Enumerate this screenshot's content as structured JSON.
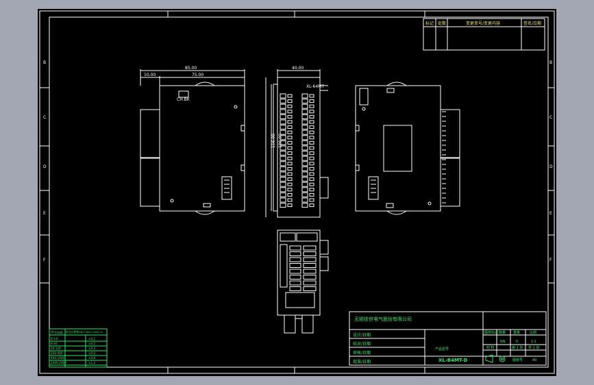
{
  "revision_table": {
    "headers": [
      "标记",
      "处数",
      "变更单号/变更内容",
      "签名/日期"
    ]
  },
  "margin_marks": {
    "left": [
      "B",
      "C",
      "D",
      "E",
      "F"
    ],
    "right": [
      "B",
      "C",
      "D",
      "E",
      "F"
    ]
  },
  "dimensions": {
    "top_overall": "85.00",
    "top_inner": "75.00",
    "top_left": "10.00",
    "side_width": "40.00",
    "side_height_a": "116.00",
    "side_height_b": "100.00",
    "model_tag": "XL-64MT"
  },
  "title_block": {
    "company": "无锡佳世电气股份有限公司",
    "rows": [
      "设计/日期",
      "校对/日期",
      "审核/日期",
      "批准/日期"
    ],
    "headers": [
      "图样标记",
      "数量",
      "重量",
      "比例"
    ],
    "qty": "NN",
    "weight": "0",
    "scale": "1:1",
    "code_label": "产品型号",
    "material": "材 料",
    "sheet_of": "第 1 张",
    "sheet_total": "共 1 张",
    "drawing_number": "XL-B4MT-D",
    "doc_label": "图纸号",
    "doc_value": "40"
  },
  "tolerance_table": {
    "header_left": "尺寸分段",
    "header_right": "未注公差按GB/T1804-2000-m",
    "rows": [
      [
        "0.5-6",
        "±0.1"
      ],
      [
        "6-30",
        "±0.2"
      ],
      [
        "30-120",
        "±0.3"
      ],
      [
        "120-400",
        "±0.5"
      ],
      [
        "400-1000",
        "±0.8"
      ],
      [
        "1000-2000",
        "±1.2"
      ]
    ]
  }
}
